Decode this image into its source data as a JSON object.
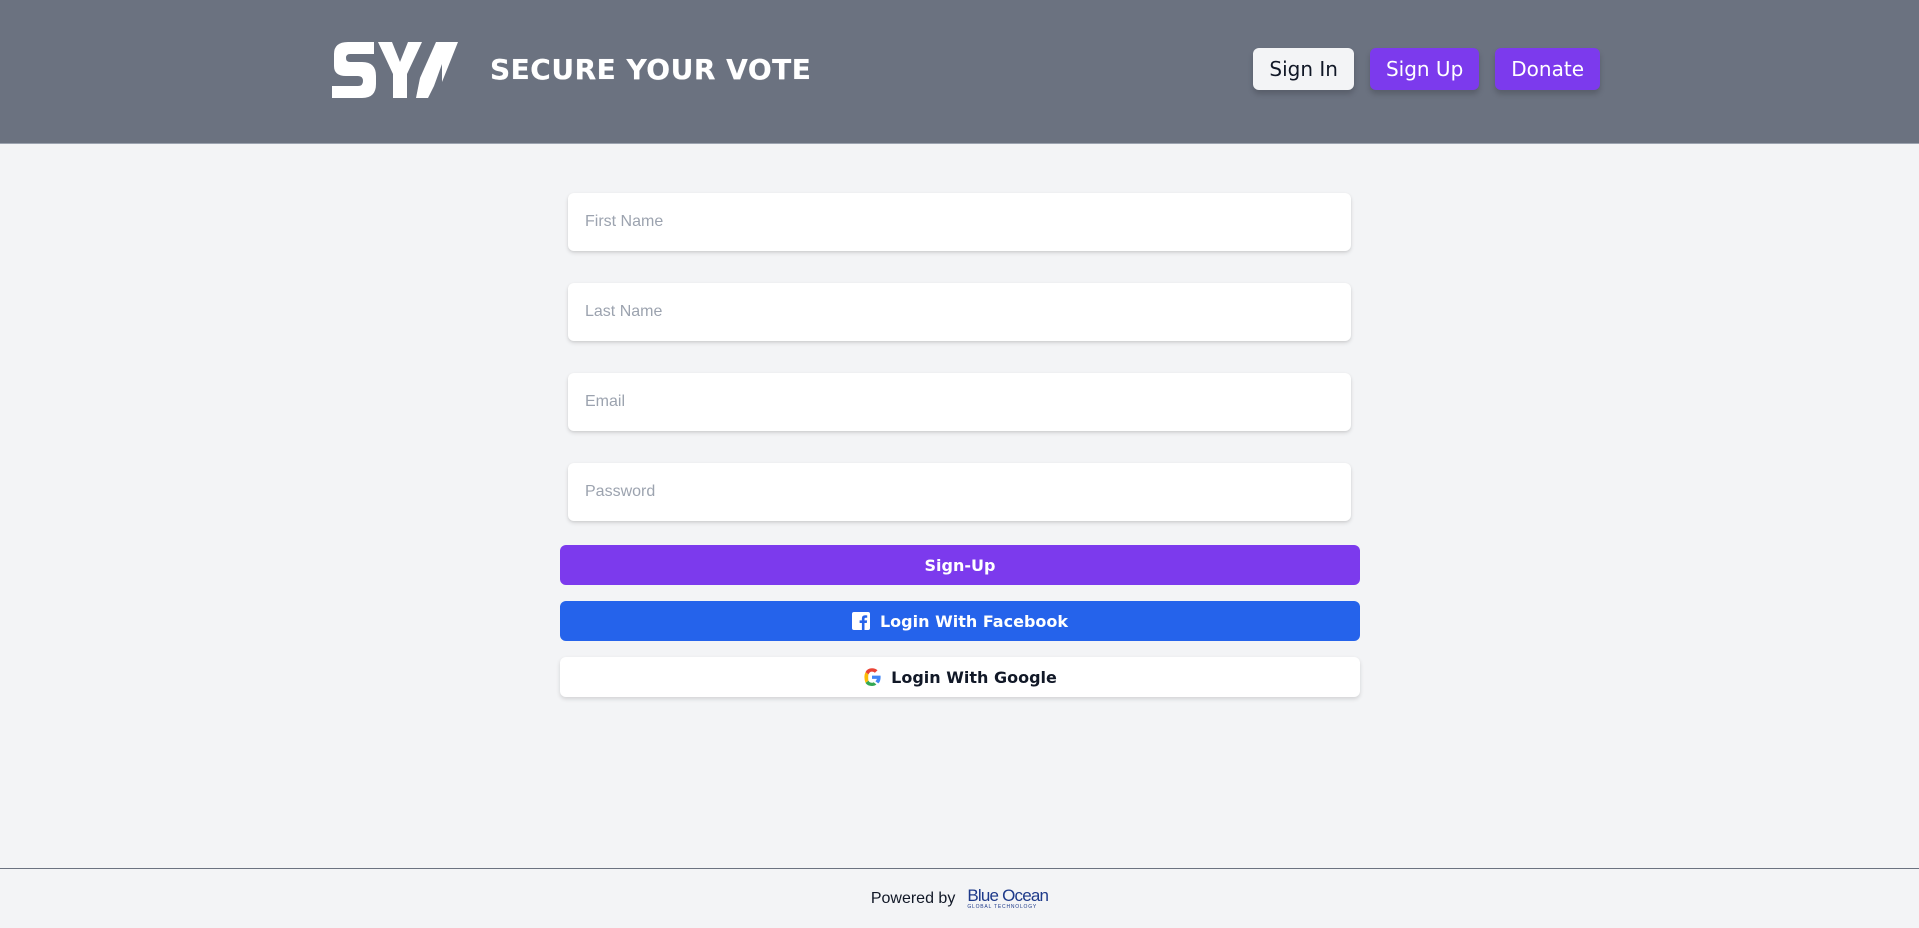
{
  "header": {
    "logo_text": "SYV",
    "title": "SECURE YOUR VOTE",
    "nav": {
      "sign_in": "Sign In",
      "sign_up": "Sign Up",
      "donate": "Donate"
    }
  },
  "form": {
    "first_name": {
      "placeholder": "First Name",
      "value": ""
    },
    "last_name": {
      "placeholder": "Last Name",
      "value": ""
    },
    "email": {
      "placeholder": "Email",
      "value": ""
    },
    "password": {
      "placeholder": "Password",
      "value": ""
    }
  },
  "actions": {
    "signup": "Sign-Up",
    "facebook": "Login With Facebook",
    "google": "Login With Google"
  },
  "footer": {
    "powered_by": "Powered by",
    "company": "Blue Ocean",
    "company_tagline": "GLOBAL TECHNOLOGY"
  },
  "colors": {
    "header_bg": "#6b7280",
    "page_bg": "#f3f4f6",
    "purple": "#7c3aed",
    "facebook_blue": "#2563eb",
    "brand_navy": "#1e3a8a"
  },
  "icons": {
    "facebook": "facebook-icon",
    "google": "google-icon",
    "logo": "syv-logo"
  }
}
